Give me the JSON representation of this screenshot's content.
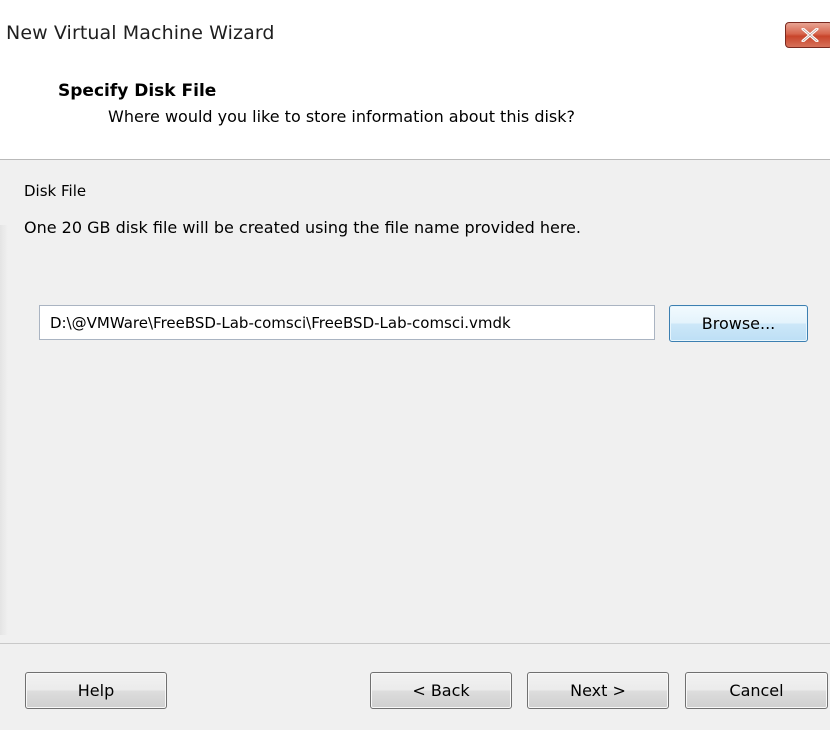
{
  "window": {
    "title": "New Virtual Machine Wizard",
    "close_icon": "close-icon"
  },
  "header": {
    "title": "Specify Disk File",
    "subtitle": "Where would you like to store information about this disk?"
  },
  "content": {
    "section_label": "Disk File",
    "description": "One 20 GB disk file will be created using the file name provided here.",
    "disk_path_value": "D:\\@VMWare\\FreeBSD-Lab-comsci\\FreeBSD-Lab-comsci.vmdk",
    "browse_label": "Browse..."
  },
  "footer": {
    "help_label": "Help",
    "back_label": "< Back",
    "next_label": "Next >",
    "cancel_label": "Cancel"
  },
  "colors": {
    "close_button": "#c8452b",
    "browse_border": "#3c7fb1",
    "window_background": "#f0f0f0"
  }
}
